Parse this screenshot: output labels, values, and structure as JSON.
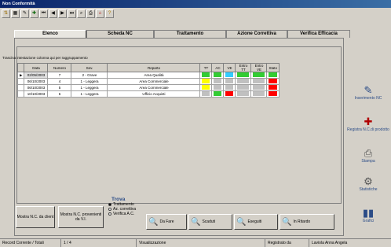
{
  "window": {
    "title": "Non Conformità"
  },
  "toolbar": {
    "icons": [
      "sort-icon",
      "grid-icon",
      "edit-icon",
      "new-icon",
      "first-icon",
      "prev-icon",
      "next-icon",
      "last-icon",
      "binoculars-icon",
      "print-icon",
      "exit-icon",
      "help-icon"
    ]
  },
  "tabs": [
    "Elenco",
    "Scheda NC",
    "Trattamento",
    "Azione Correttiva",
    "Verifica Efficacia"
  ],
  "grid": {
    "group_hint": "Trascina intestazione colonna qui per raggruppamento",
    "headers": [
      "Data",
      "Numero",
      "Sev.",
      "Reparto",
      "TT",
      "AC",
      "VE",
      "Entro TT",
      "Entro VE",
      "Stato"
    ],
    "rows": [
      {
        "date": "02/05/2003",
        "num": "7",
        "sev": "2 - Grave",
        "rep": "Area Qualità",
        "colors": [
          "#33cc33",
          "#33cc33",
          "#33ccff",
          "#33cc33",
          "#33cc33",
          "#33cc33"
        ]
      },
      {
        "date": "06/10/2003",
        "num": "4",
        "sev": "1 - Leggera",
        "rep": "Area Commerciale",
        "colors": [
          "#ffff00",
          "#c0c0c0",
          "#c0c0c0",
          "#c0c0c0",
          "#c0c0c0",
          "#ff0000"
        ]
      },
      {
        "date": "06/10/2003",
        "num": "5",
        "sev": "1 - Leggera",
        "rep": "Area Commerciale",
        "colors": [
          "#ffff00",
          "#c0c0c0",
          "#c0c0c0",
          "#c0c0c0",
          "#c0c0c0",
          "#ff0000"
        ]
      },
      {
        "date": "10/10/2003",
        "num": "6",
        "sev": "1 - Leggera",
        "rep": "Ufficio Acquisti",
        "colors": [
          "#c0c0c0",
          "#33cc33",
          "#ff0000",
          "#c0c0c0",
          "#c0c0c0",
          "#ff0000"
        ]
      }
    ]
  },
  "sidebar": {
    "items": [
      {
        "label": "Inserimento NC",
        "icon": "edit-note-icon"
      },
      {
        "label": "Registra N.C.di prodotto",
        "icon": "register-icon"
      },
      {
        "label": "Stampa",
        "icon": "print-icon"
      },
      {
        "label": "Statistiche",
        "icon": "stats-icon"
      },
      {
        "label": "Grafici",
        "icon": "chart-icon"
      }
    ]
  },
  "bottom": {
    "show_client": "Mostra N.C. da client",
    "show_supplier": "Mostra N.C. provenienti da V.I.",
    "trova_title": "Trova",
    "radios": [
      "Trattamento",
      "Az. correttiva",
      "Verifica A.C."
    ],
    "filter_buttons": [
      "Da Fare",
      "Scaduti",
      "Eseguiti",
      "In Ritardo"
    ]
  },
  "status": {
    "record": "Record Corrente / Totali",
    "count": "1 / 4",
    "mode": "Visualizzazione",
    "reg": "Registrato da",
    "user": "Laviola Anna Angela"
  }
}
